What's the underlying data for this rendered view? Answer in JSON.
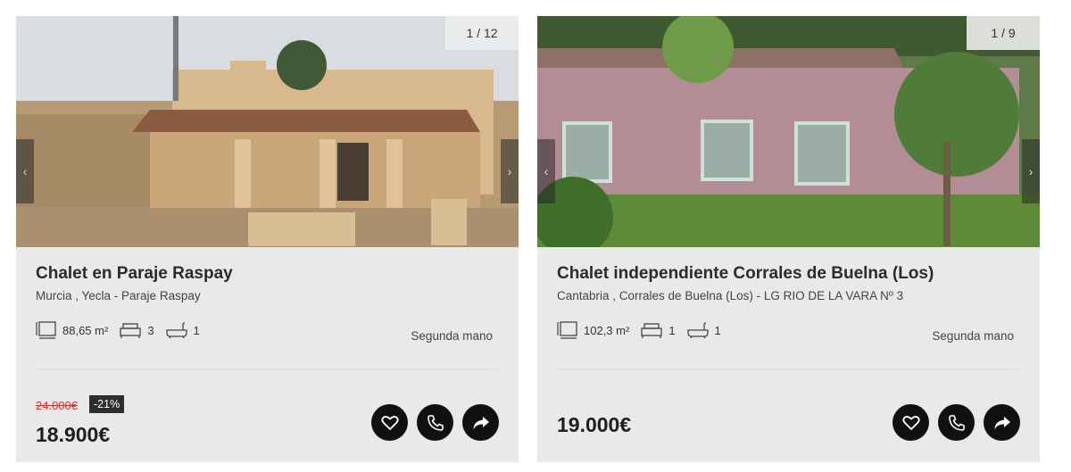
{
  "listings": [
    {
      "image_counter": "1 / 12",
      "title": "Chalet en Paraje Raspay",
      "location": "Murcia , Yecla - Paraje Raspay",
      "area": "88,65 m²",
      "bedrooms": "3",
      "bathrooms": "1",
      "condition": "Segunda mano",
      "old_price": "24.000€",
      "discount": "-21%",
      "price": "18.900€"
    },
    {
      "image_counter": "1 / 9",
      "title": "Chalet independiente Corrales de Buelna (Los)",
      "location": "Cantabria , Corrales de Buelna (Los) - LG RIO DE LA VARA Nº 3",
      "area": "102,3 m²",
      "bedrooms": "1",
      "bathrooms": "1",
      "condition": "Segunda mano",
      "price": "19.000€"
    }
  ],
  "icons": {
    "area": "floor-plan-icon",
    "bed": "bed-icon",
    "bath": "bathtub-icon",
    "favorite": "heart-icon",
    "call": "phone-icon",
    "share": "share-icon",
    "prev": "chevron-left-icon",
    "next": "chevron-right-icon"
  },
  "colors": {
    "card_bg": "#e9e9e9",
    "action_bg": "#111111",
    "old_price": "#cc3333",
    "discount_bg": "#2d2d2d"
  }
}
